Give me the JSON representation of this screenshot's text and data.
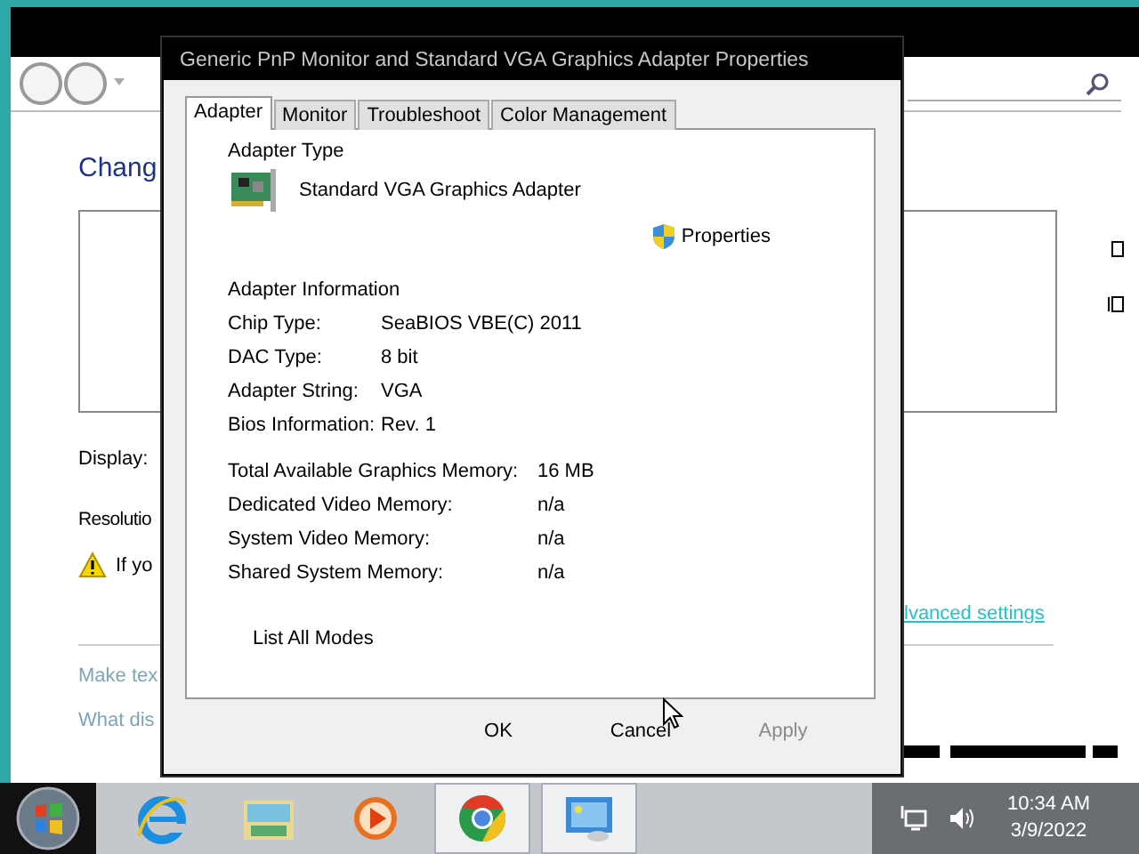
{
  "background_window": {
    "heading": "Chang",
    "display_label": "Display:",
    "resolution_label": "Resolutio",
    "warning_text": "If yo",
    "links": [
      "Make tex",
      "What dis"
    ],
    "advanced_link": "lvanced settings"
  },
  "dialog": {
    "title": "Generic PnP Monitor and Standard VGA Graphics Adapter Properties",
    "tabs": [
      {
        "label": "Adapter",
        "selected": true
      },
      {
        "label": "Monitor",
        "selected": false
      },
      {
        "label": "Troubleshoot",
        "selected": false
      },
      {
        "label": "Color Management",
        "selected": false
      }
    ],
    "adapter_type_label": "Adapter Type",
    "adapter_name": "Standard VGA Graphics Adapter",
    "properties_button": "Properties",
    "info_heading": "Adapter Information",
    "info": [
      {
        "label": "Chip Type:",
        "value": "SeaBIOS VBE(C) 2011"
      },
      {
        "label": "DAC Type:",
        "value": "8 bit"
      },
      {
        "label": "Adapter String:",
        "value": "VGA"
      },
      {
        "label": "Bios Information:",
        "value": "Rev. 1"
      }
    ],
    "memory": [
      {
        "label": "Total Available Graphics Memory:",
        "value": "16 MB"
      },
      {
        "label": "Dedicated Video Memory:",
        "value": "n/a"
      },
      {
        "label": "System Video Memory:",
        "value": "n/a"
      },
      {
        "label": "Shared System Memory:",
        "value": "n/a"
      }
    ],
    "list_modes_button": "List All Modes",
    "buttons": [
      {
        "label": "OK",
        "disabled": false
      },
      {
        "label": "Cancel",
        "disabled": false
      },
      {
        "label": "Apply",
        "disabled": true
      }
    ]
  },
  "taskbar": {
    "apps": [
      {
        "kind": "browser",
        "active": false
      },
      {
        "kind": "folder",
        "active": false
      },
      {
        "kind": "media",
        "active": false
      },
      {
        "kind": "chrome",
        "active": true
      },
      {
        "kind": "control",
        "active": true
      }
    ],
    "clock": {
      "time": "10:34 AM",
      "date": "3/9/2022"
    }
  }
}
